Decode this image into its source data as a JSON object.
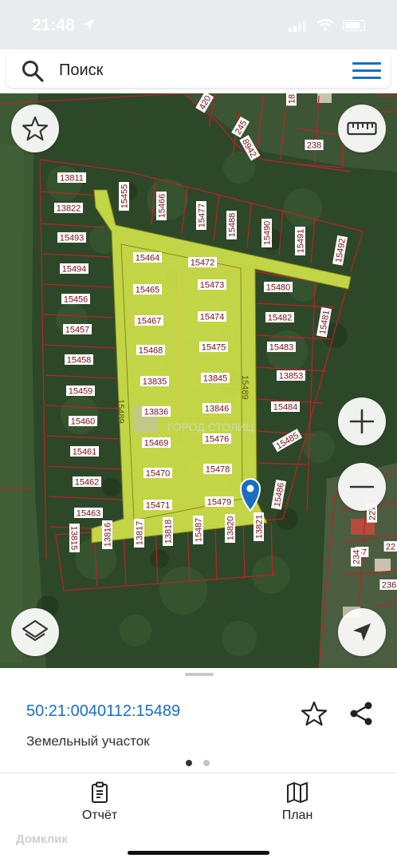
{
  "status_bar": {
    "time": "21:48"
  },
  "search": {
    "placeholder": "Поиск"
  },
  "map": {
    "road_label_vertical_left": "15489",
    "road_label_vertical_right": "15489",
    "watermark": "ГОРОД СТОЛИЦ",
    "parcels": [
      "420",
      "245",
      "8942",
      "238",
      "18",
      "13811",
      "13822",
      "15493",
      "15494",
      "15456",
      "15457",
      "15458",
      "15459",
      "15460",
      "15461",
      "15462",
      "15463",
      "15455",
      "15466",
      "15477",
      "15488",
      "15490",
      "15491",
      "15492",
      "15464",
      "15472",
      "15465",
      "15473",
      "15480",
      "15467",
      "15474",
      "15482",
      "15481",
      "15468",
      "15475",
      "15483",
      "13835",
      "13845",
      "13853",
      "13836",
      "13846",
      "15484",
      "15469",
      "15476",
      "15485",
      "15470",
      "15478",
      "15471",
      "15479",
      "15486",
      "13815",
      "13816",
      "13817",
      "13818",
      "15487",
      "13820",
      "13821",
      "227",
      "67",
      "234",
      "22",
      "236"
    ]
  },
  "sheet": {
    "cadastral_number": "50:21:0040112:15489",
    "parcel_type": "Земельный участок",
    "tabs": [
      {
        "label": "Отчёт"
      },
      {
        "label": "План"
      }
    ],
    "watermark": "Домклик"
  },
  "colors": {
    "accent": "#1a6ec0",
    "highlight": "#d6e84a",
    "boundary": "#c0202a",
    "forest": "#2f4a2c"
  }
}
